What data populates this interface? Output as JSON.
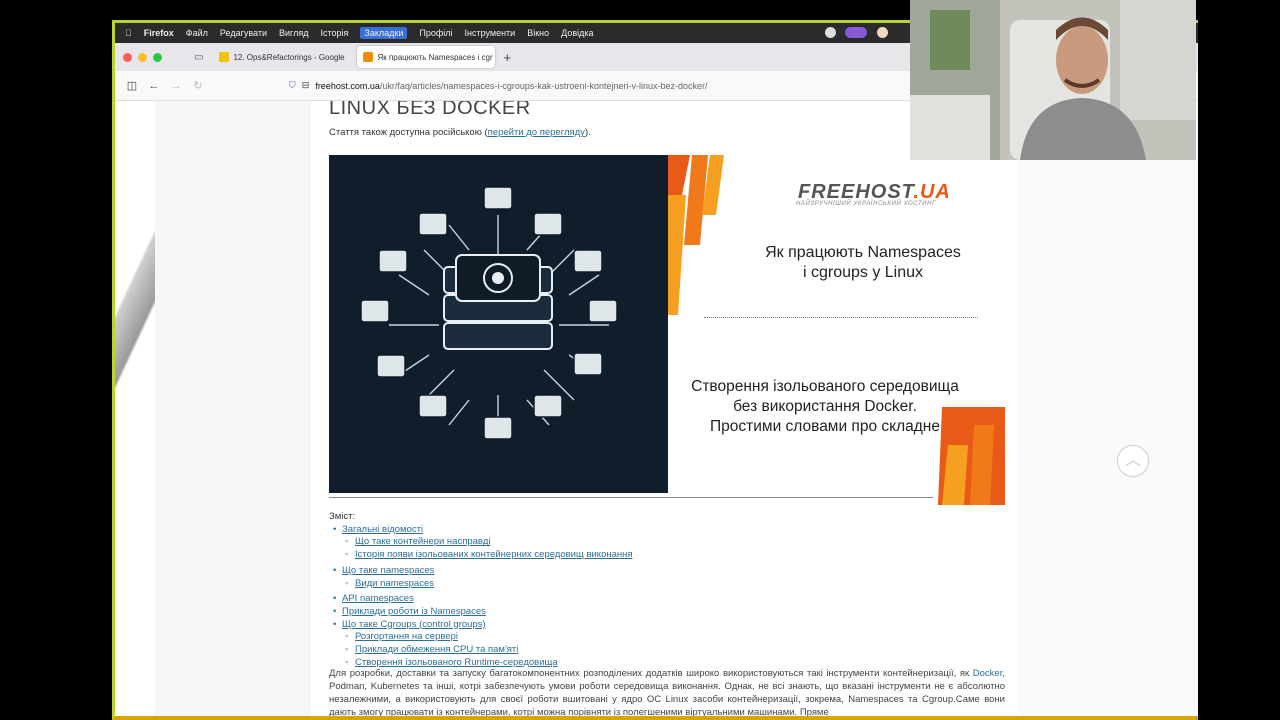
{
  "menubar": {
    "items": [
      "Firefox",
      "Файл",
      "Редагувати",
      "Вигляд",
      "Історія",
      "Закладки",
      "Профілі",
      "Інструменти",
      "Вікно",
      "Довідка"
    ]
  },
  "tabs": [
    {
      "label": "12. Ops&Refactorings - Google",
      "favicon_color": "#f2c200"
    },
    {
      "label": "Як працюють Namespaces і cgr",
      "favicon_color": "#f28c00"
    }
  ],
  "url": {
    "host": "freehost.com.ua",
    "path": "/ukr/faq/articles/namespaces-i-cgroups-kak-ustroeni-kontejneri-v-linux-bez-docker/"
  },
  "article": {
    "title": "LINUX БЕЗ DOCKER",
    "also_prefix": "Стаття також доступна російською (",
    "also_link": "перейти до перегляду",
    "also_suffix": ")."
  },
  "banner": {
    "logo_main": "FREEHOST",
    "logo_suffix": ".UA",
    "slogan": "НАЙЗРУЧНІШИЙ УКРАЇНСЬКИЙ ХОСТИНГ",
    "heading1_line1": "Як працюють Namespaces",
    "heading1_line2": "і cgroups у Linux",
    "heading2_line1": "Створення ізольованого середовища",
    "heading2_line2": "без використання Docker.",
    "heading2_line3": "Простими словами про складне"
  },
  "toc": {
    "label": "Зміст:",
    "items": [
      {
        "text": "Загальні відомості",
        "level": 1
      },
      {
        "text": "Що таке контейнери насправді",
        "level": 2
      },
      {
        "text": "Історія появи ізольованих контейнерних середовищ виконання",
        "level": 2
      },
      {
        "text": "Що таке namespaces",
        "level": 1
      },
      {
        "text": "Види namespaces",
        "level": 2
      },
      {
        "text": "API namespaces",
        "level": 1
      },
      {
        "text": "Приклади роботи із Namespaces",
        "level": 1
      },
      {
        "text": "Що таке Cgroups (control groups)",
        "level": 1
      },
      {
        "text": "Розгортання на сервері",
        "level": 2
      },
      {
        "text": "Приклади обмеження CPU та пам'яті",
        "level": 2
      },
      {
        "text": "Створення ізольованого Runtime-середовища",
        "level": 2
      }
    ]
  },
  "paragraph": {
    "part1": "Для розробки, доставки та запуску багатокомпонентних розподілених додатків широко використовуються такі інструменти контейнеризації, як ",
    "link": "Docker",
    "part2": ", Podman, Kubernetes та інші, котрі забезпечують умови роботи середовища виконання. Однак, не всі знають, що вказані інструменти не є абсолютно незалежними, а використовують для своєї роботи вшитовані у ядро ОС Linux засоби контейнеризації, зокрема, Namespaces та Cgroup.Саме вони дають змогу працювати із контейнерами, котрі можна порівняти із полегшеними віртуальними машинами. Пряме"
  },
  "colors": {
    "accent_link": "#2a6f9a",
    "brand_orange": "#e95a18",
    "banner_dark": "#101e2b"
  }
}
